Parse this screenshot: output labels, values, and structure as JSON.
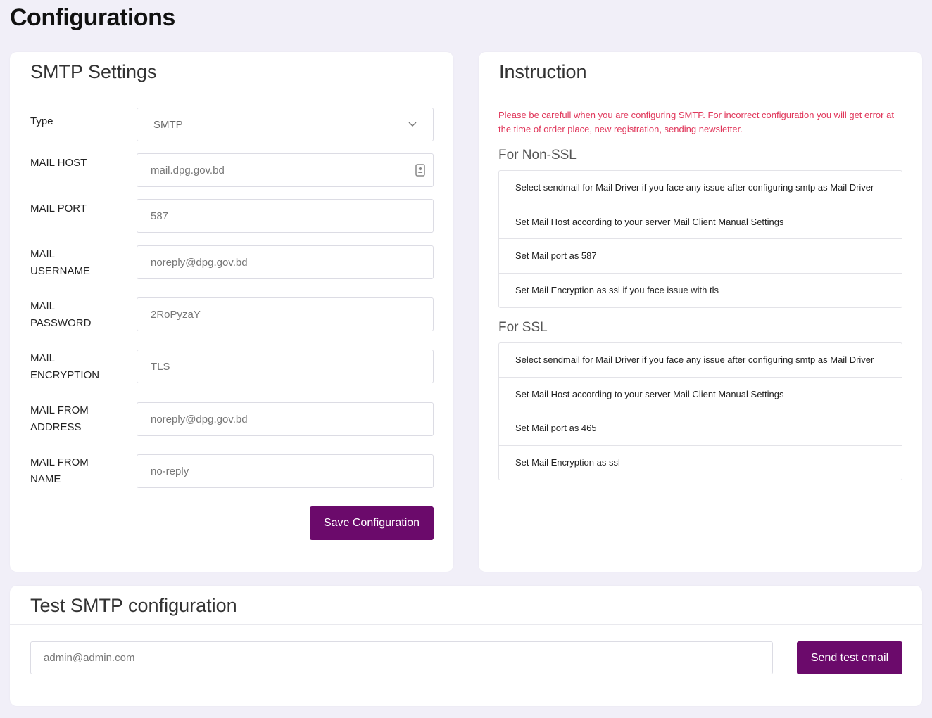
{
  "page": {
    "title": "Configurations"
  },
  "smtp": {
    "header": "SMTP Settings",
    "fields": [
      {
        "label": "Type",
        "value": "SMTP"
      },
      {
        "label": "MAIL HOST",
        "value": "mail.dpg.gov.bd"
      },
      {
        "label": "MAIL PORT",
        "value": "587"
      },
      {
        "label": "MAIL USERNAME",
        "value": "noreply@dpg.gov.bd"
      },
      {
        "label": "MAIL PASSWORD",
        "value": "2RoPyzaY"
      },
      {
        "label": "MAIL ENCRYPTION",
        "value": "TLS"
      },
      {
        "label": "MAIL FROM ADDRESS",
        "value": "noreply@dpg.gov.bd"
      },
      {
        "label": "MAIL FROM NAME",
        "value": "no-reply"
      }
    ],
    "save_label": "Save Configuration"
  },
  "instruction": {
    "header": "Instruction",
    "warning": "Please be carefull when you are configuring SMTP. For incorrect configuration you will get error at the time of order place, new registration, sending newsletter.",
    "non_ssl": {
      "title": "For Non-SSL",
      "items": [
        "Select sendmail for Mail Driver if you face any issue after configuring smtp as Mail Driver",
        "Set Mail Host according to your server Mail Client Manual Settings",
        "Set Mail port as 587",
        "Set Mail Encryption as ssl if you face issue with tls"
      ]
    },
    "ssl": {
      "title": "For SSL",
      "items": [
        "Select sendmail for Mail Driver if you face any issue after configuring smtp as Mail Driver",
        "Set Mail Host according to your server Mail Client Manual Settings",
        "Set Mail port as 465",
        "Set Mail Encryption as ssl"
      ]
    }
  },
  "test": {
    "header": "Test SMTP configuration",
    "email_value": "admin@admin.com",
    "send_label": "Send test email"
  },
  "colors": {
    "primary": "#6b0a6b",
    "warning": "#e0365a",
    "background": "#f1eff8"
  }
}
